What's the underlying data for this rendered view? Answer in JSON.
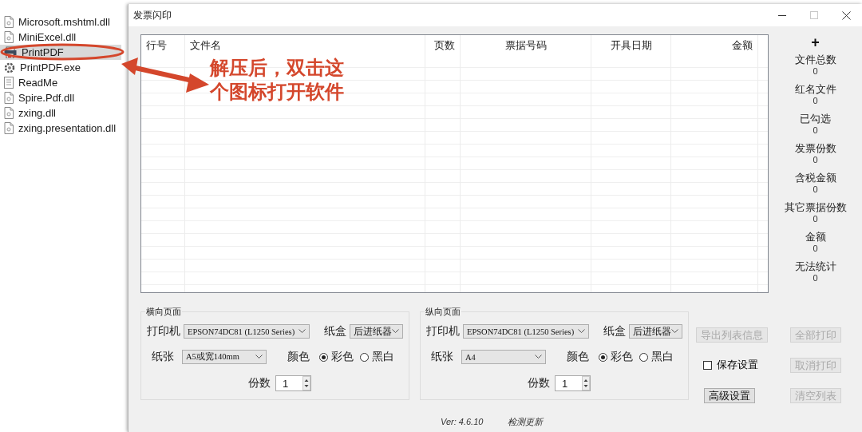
{
  "explorer": {
    "files": [
      {
        "name": "Microsoft.mshtml.dll",
        "kind": "dll",
        "selected": false
      },
      {
        "name": "MiniExcel.dll",
        "kind": "dll",
        "selected": false
      },
      {
        "name": "PrintPDF",
        "kind": "shortcut",
        "selected": true
      },
      {
        "name": "PrintPDF.exe",
        "kind": "exe",
        "selected": false
      },
      {
        "name": "ReadMe",
        "kind": "text",
        "selected": false
      },
      {
        "name": "Spire.Pdf.dll",
        "kind": "dll",
        "selected": false
      },
      {
        "name": "zxing.dll",
        "kind": "dll",
        "selected": false
      },
      {
        "name": "zxing.presentation.dll",
        "kind": "dll",
        "selected": false
      }
    ]
  },
  "annotation": {
    "text": "解压后，双击这个图标打开软件"
  },
  "window": {
    "title": "发票闪印"
  },
  "table": {
    "columns": [
      "行号",
      "文件名",
      "页数",
      "票据号码",
      "开具日期",
      "金额"
    ]
  },
  "add_button": "+",
  "stats": [
    {
      "label": "文件总数",
      "value": "0"
    },
    {
      "label": "红名文件",
      "value": "0"
    },
    {
      "label": "已勾选",
      "value": "0"
    },
    {
      "label": "发票份数",
      "value": "0"
    },
    {
      "label": "含税金额",
      "value": "0"
    },
    {
      "label": "其它票据份数",
      "value": "0"
    },
    {
      "label": "金额",
      "value": "0"
    },
    {
      "label": "无法统计",
      "value": "0"
    }
  ],
  "landscape": {
    "title": "横向页面",
    "printer_label": "打印机",
    "printer": "EPSON74DC81 (L1250 Series)",
    "tray_label": "纸盒",
    "tray": "后进纸器",
    "paper_label": "纸张",
    "paper": "A5或宽140mm",
    "color_label": "颜色",
    "color_options": [
      {
        "label": "彩色",
        "selected": true
      },
      {
        "label": "黑白",
        "selected": false
      }
    ],
    "copies_label": "份数",
    "copies": "1"
  },
  "portrait": {
    "title": "纵向页面",
    "printer_label": "打印机",
    "printer": "EPSON74DC81 (L1250 Series)",
    "tray_label": "纸盒",
    "tray": "后进纸器",
    "paper_label": "纸张",
    "paper": "A4",
    "color_label": "颜色",
    "color_options": [
      {
        "label": "彩色",
        "selected": true
      },
      {
        "label": "黑白",
        "selected": false
      }
    ],
    "copies_label": "份数",
    "copies": "1"
  },
  "actions": [
    {
      "kind": "button",
      "label": "导出列表信息",
      "disabled": true
    },
    {
      "kind": "button",
      "label": "全部打印",
      "disabled": true
    },
    {
      "kind": "checkbox",
      "label": "保存设置",
      "checked": false
    },
    {
      "kind": "button",
      "label": "取消打印",
      "disabled": true
    },
    {
      "kind": "button",
      "label": "高级设置",
      "disabled": false
    },
    {
      "kind": "button",
      "label": "清空列表",
      "disabled": true
    }
  ],
  "footer": {
    "version": "Ver: 4.6.10",
    "update_link": "检测更新"
  }
}
